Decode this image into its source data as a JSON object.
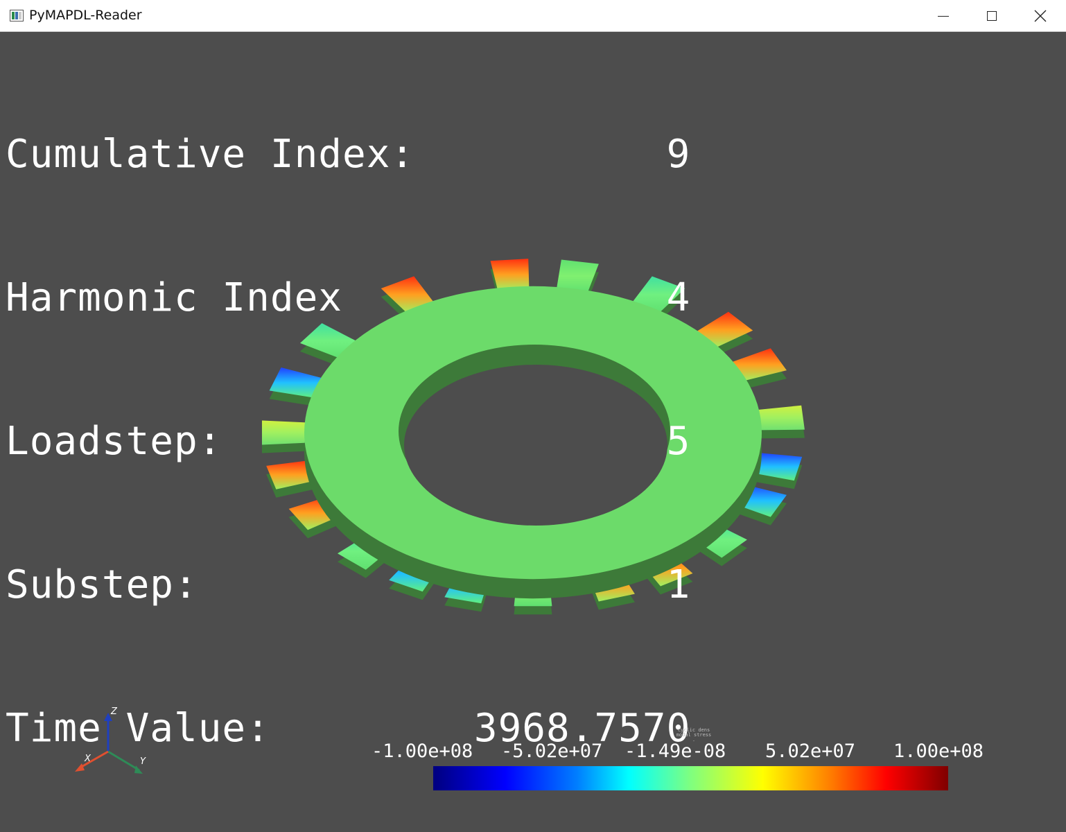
{
  "window": {
    "title": "PyMAPDL-Reader",
    "controls": {
      "minimize": "minimize-icon",
      "maximize": "maximize-icon",
      "close": "close-icon"
    }
  },
  "info": [
    {
      "label": "Cumulative Index:",
      "value": "9"
    },
    {
      "label": "Harmonic Index",
      "value": "4"
    },
    {
      "label": "Loadstep:",
      "value": "5"
    },
    {
      "label": "Substep:",
      "value": "1"
    },
    {
      "label": "Time Value:",
      "value": "3968.7570"
    }
  ],
  "colorbar": {
    "title_line1": "cyclic dens",
    "title_line2": "modal stress",
    "title_line3": ".",
    "labels": [
      "-1.00e+08",
      "-5.02e+07",
      "-1.49e-08",
      "5.02e+07",
      "1.00e+08"
    ],
    "min": -100000000,
    "max": 100000000
  },
  "axes": {
    "x_label": "X",
    "y_label": "Y",
    "z_label": "Z"
  },
  "colors": {
    "background": "#4d4d4d",
    "disk_face": "#6cdb6a",
    "disk_side": "#3d7a39",
    "x_axis": "#e05030",
    "y_axis": "#2e8b57",
    "z_axis": "#1f3fbf"
  }
}
